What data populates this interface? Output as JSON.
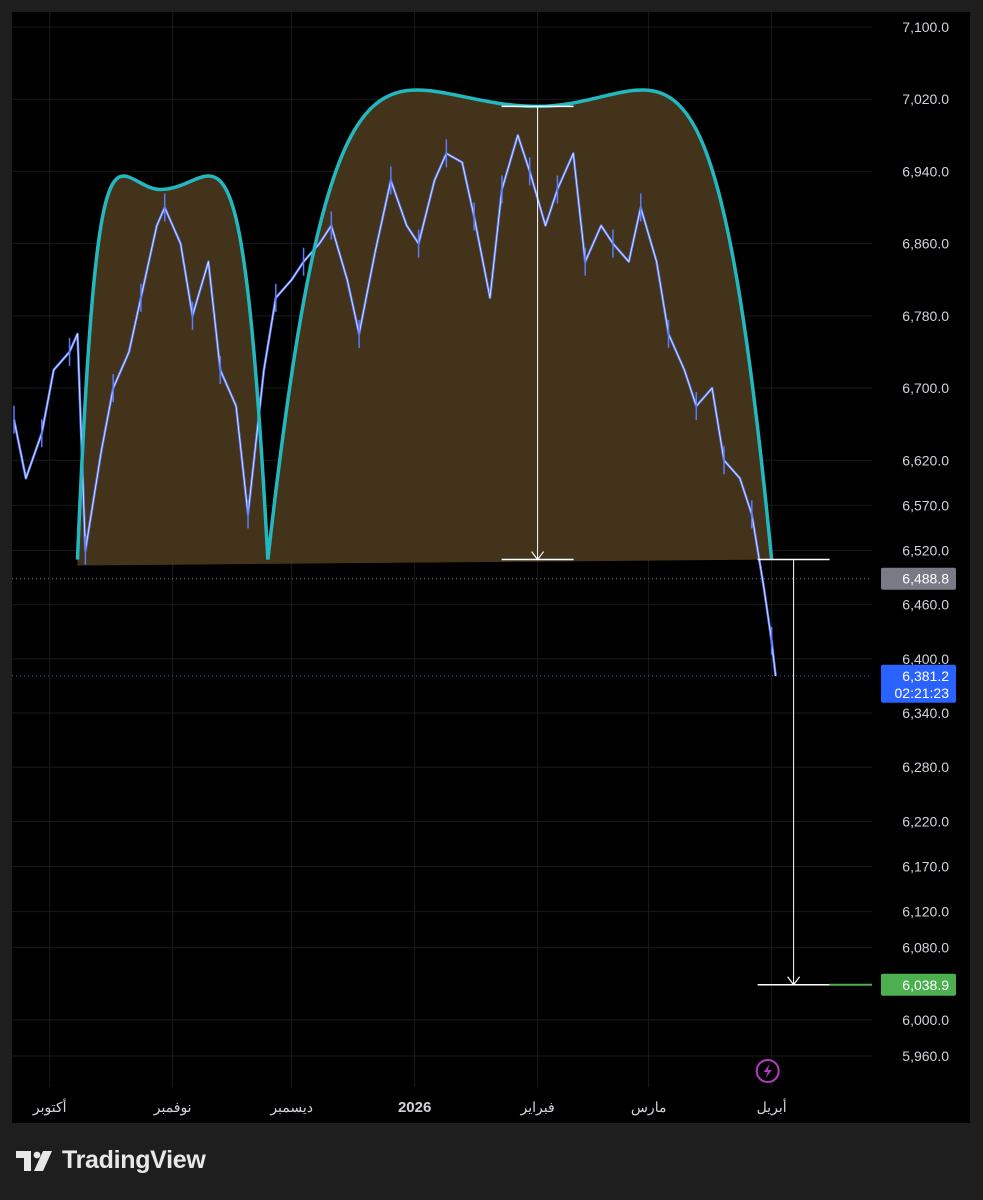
{
  "brand": {
    "name": "TradingView",
    "logo_icon": "tradingview-logo-icon"
  },
  "chart_data": {
    "type": "line",
    "y_ticks": [
      7100,
      7020,
      6940,
      6860,
      6780,
      6700,
      6620,
      6570,
      6520,
      6460,
      6400,
      6340,
      6280,
      6220,
      6170,
      6120,
      6080,
      6000,
      5960
    ],
    "y_tick_labels": [
      "7,100.0",
      "7,020.0",
      "6,940.0",
      "6,860.0",
      "6,780.0",
      "6,700.0",
      "6,620.0",
      "6,570.0",
      "6,520.0",
      "6,460.0",
      "6,400.0",
      "6,340.0",
      "6,280.0",
      "6,220.0",
      "6,170.0",
      "6,120.0",
      "6,080.0",
      "6,000.0",
      "5,960.0"
    ],
    "x_ticks": [
      {
        "label": "أكتوبر",
        "date": "2025-10-01",
        "bold": false
      },
      {
        "label": "نوفمبر",
        "date": "2025-11-01",
        "bold": false
      },
      {
        "label": "ديسمبر",
        "date": "2025-12-01",
        "bold": false
      },
      {
        "label": "2026",
        "date": "2026-01-01",
        "bold": true
      },
      {
        "label": "فبراير",
        "date": "2026-02-01",
        "bold": false
      },
      {
        "label": "مارس",
        "date": "2026-03-01",
        "bold": false
      },
      {
        "label": "أبريل",
        "date": "2026-04-01",
        "bold": false
      }
    ],
    "x_range": [
      "2025-09-22",
      "2026-04-20"
    ],
    "price_series": {
      "color": "#5b7cfa",
      "points": [
        [
          "2025-09-22",
          6665
        ],
        [
          "2025-09-25",
          6600
        ],
        [
          "2025-09-29",
          6650
        ],
        [
          "2025-10-02",
          6720
        ],
        [
          "2025-10-06",
          6740
        ],
        [
          "2025-10-08",
          6760
        ],
        [
          "2025-10-10",
          6520
        ],
        [
          "2025-10-14",
          6630
        ],
        [
          "2025-10-17",
          6700
        ],
        [
          "2025-10-21",
          6740
        ],
        [
          "2025-10-24",
          6800
        ],
        [
          "2025-10-28",
          6880
        ],
        [
          "2025-10-30",
          6900
        ],
        [
          "2025-11-03",
          6860
        ],
        [
          "2025-11-06",
          6780
        ],
        [
          "2025-11-10",
          6840
        ],
        [
          "2025-11-13",
          6720
        ],
        [
          "2025-11-17",
          6680
        ],
        [
          "2025-11-20",
          6560
        ],
        [
          "2025-11-24",
          6720
        ],
        [
          "2025-11-27",
          6800
        ],
        [
          "2025-12-01",
          6820
        ],
        [
          "2025-12-04",
          6840
        ],
        [
          "2025-12-08",
          6860
        ],
        [
          "2025-12-11",
          6880
        ],
        [
          "2025-12-15",
          6820
        ],
        [
          "2025-12-18",
          6760
        ],
        [
          "2025-12-22",
          6850
        ],
        [
          "2025-12-26",
          6930
        ],
        [
          "2025-12-30",
          6880
        ],
        [
          "2026-01-02",
          6860
        ],
        [
          "2026-01-06",
          6930
        ],
        [
          "2026-01-09",
          6960
        ],
        [
          "2026-01-13",
          6950
        ],
        [
          "2026-01-16",
          6890
        ],
        [
          "2026-01-20",
          6800
        ],
        [
          "2026-01-23",
          6920
        ],
        [
          "2026-01-27",
          6980
        ],
        [
          "2026-01-30",
          6940
        ],
        [
          "2026-02-03",
          6880
        ],
        [
          "2026-02-06",
          6920
        ],
        [
          "2026-02-10",
          6960
        ],
        [
          "2026-02-13",
          6840
        ],
        [
          "2026-02-17",
          6880
        ],
        [
          "2026-02-20",
          6860
        ],
        [
          "2026-02-24",
          6840
        ],
        [
          "2026-02-27",
          6900
        ],
        [
          "2026-03-03",
          6840
        ],
        [
          "2026-03-06",
          6760
        ],
        [
          "2026-03-10",
          6720
        ],
        [
          "2026-03-13",
          6680
        ],
        [
          "2026-03-17",
          6700
        ],
        [
          "2026-03-20",
          6620
        ],
        [
          "2026-03-24",
          6600
        ],
        [
          "2026-03-27",
          6560
        ],
        [
          "2026-03-30",
          6480
        ],
        [
          "2026-04-01",
          6420
        ],
        [
          "2026-04-02",
          6381
        ]
      ]
    },
    "pattern": {
      "type": "double cup",
      "fill_color": "#43331a",
      "arc_color": "#22b8bf",
      "neckline_price": 6510,
      "cup1": {
        "left": "2025-10-08",
        "right": "2025-11-25",
        "peak_date": "2025-10-29",
        "peak": 6920
      },
      "cup2": {
        "left": "2025-11-25",
        "right": "2026-04-01",
        "peak_date": "2026-02-01",
        "peak": 7012
      }
    },
    "measure": {
      "color": "#ffffff",
      "depth_date": "2026-02-01",
      "depth_top": 7012,
      "depth_bottom": 6510,
      "target_date": "2026-04-02",
      "target_top": 6510,
      "target_bottom": 6038.9
    },
    "price_lines": [
      {
        "value": 6488.8,
        "label": "6,488.8",
        "color": "#787b86",
        "text_color": "#ffffff",
        "style": "dotted"
      },
      {
        "value": 6381.2,
        "label": "6,381.2",
        "sublabel": "02:21:23",
        "color": "#2962ff",
        "text_color": "#ffffff",
        "style": "dotted"
      },
      {
        "value": 6038.9,
        "label": "6,038.9",
        "color": "#4caf50",
        "text_color": "#ffffff",
        "style": "none"
      }
    ],
    "event_icon": {
      "name": "lightning-icon",
      "date": "2026-03-30",
      "color": "#b53ac5"
    },
    "grid": true
  }
}
